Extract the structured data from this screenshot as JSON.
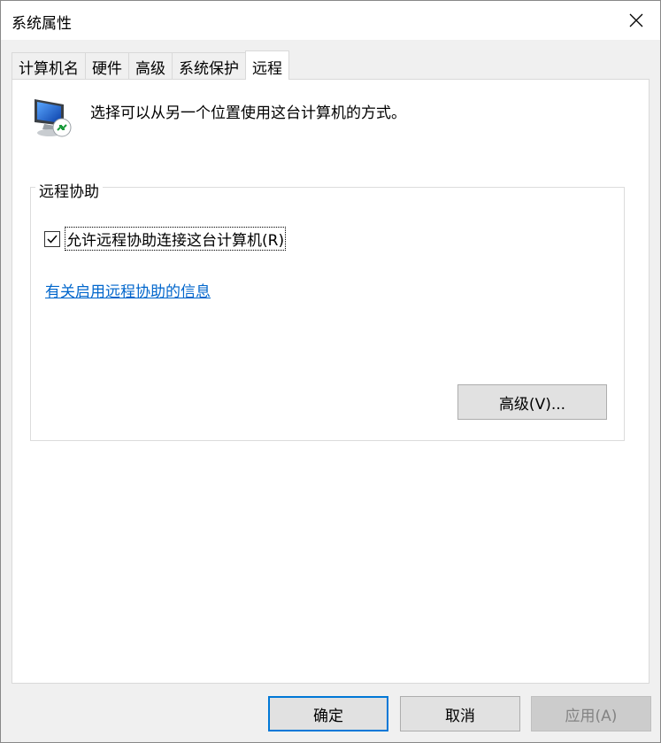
{
  "window": {
    "title": "系统属性"
  },
  "tabs": [
    {
      "label": "计算机名"
    },
    {
      "label": "硬件"
    },
    {
      "label": "高级"
    },
    {
      "label": "系统保护"
    },
    {
      "label": "远程",
      "active": true
    }
  ],
  "panel": {
    "intro": "选择可以从另一个位置使用这台计算机的方式。",
    "group_label": "远程协助",
    "checkbox_label": "允许远程协助连接这台计算机(R)",
    "checkbox_checked": true,
    "link_text": "有关启用远程协助的信息",
    "advanced_button": "高级(V)..."
  },
  "footer": {
    "ok": "确定",
    "cancel": "取消",
    "apply": "应用(A)",
    "apply_disabled": true
  },
  "colors": {
    "link": "#0066cc",
    "focus_border": "#0078d7"
  }
}
